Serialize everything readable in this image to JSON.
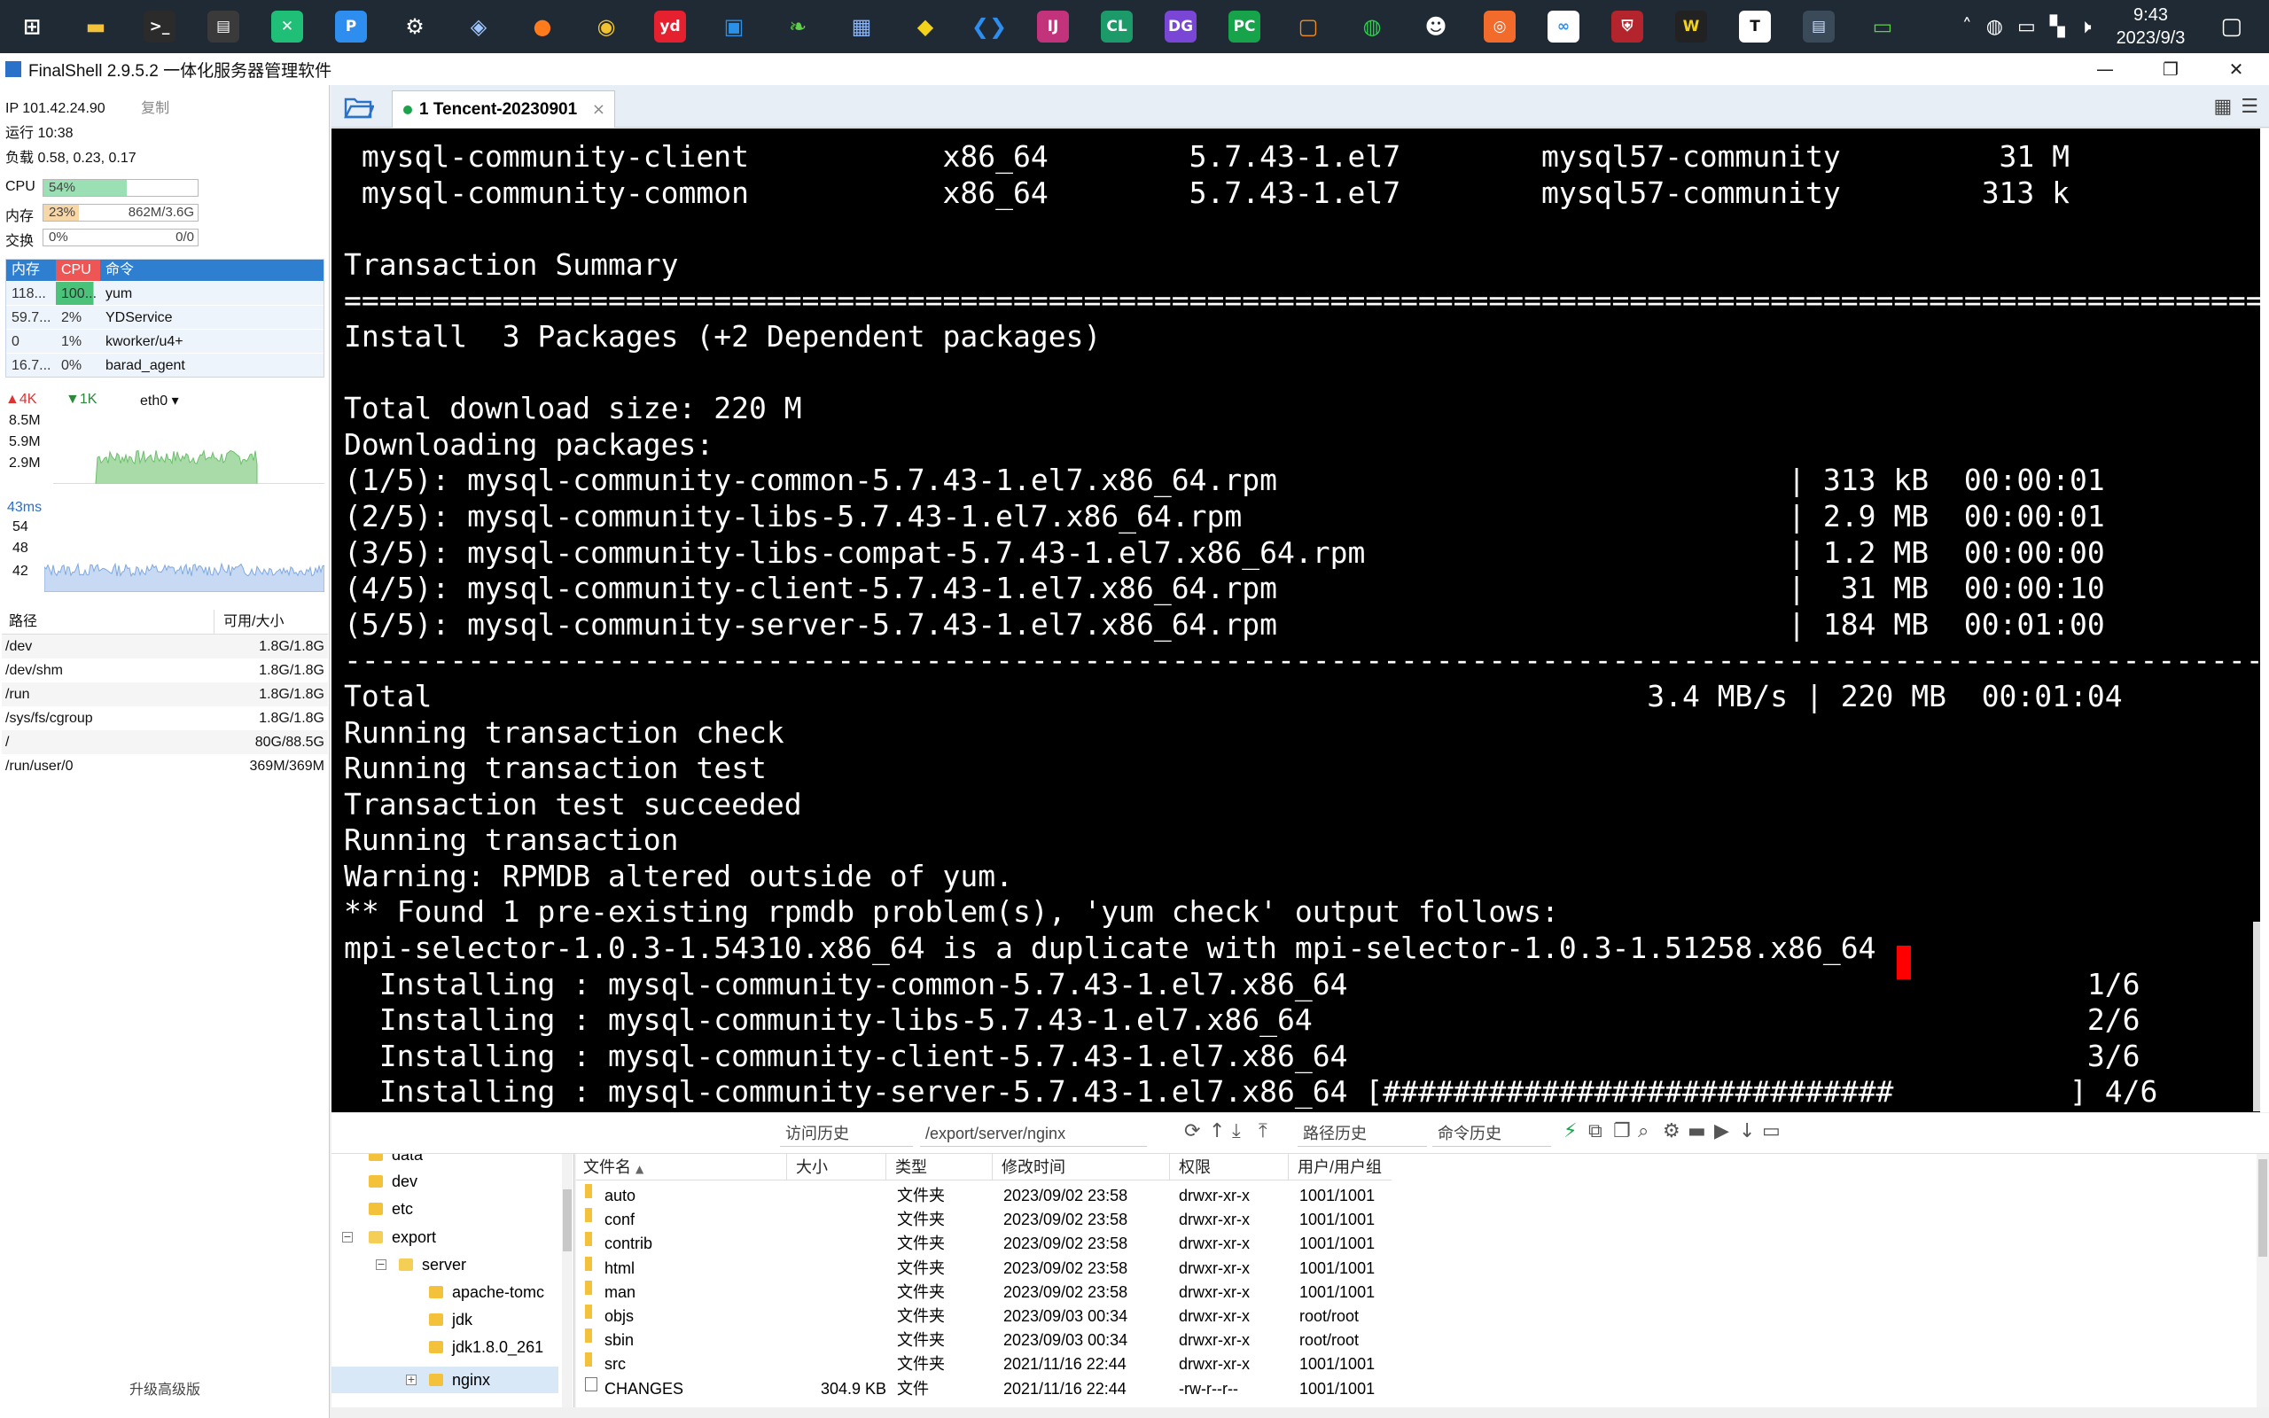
{
  "taskbar": {
    "apps": [
      {
        "name": "start-icon",
        "glyph": "⊞",
        "color": "#ffffff",
        "bg": "transparent"
      },
      {
        "name": "file-explorer-icon",
        "glyph": "▬",
        "color": "#f3c23a",
        "bg": "transparent"
      },
      {
        "name": "terminal-icon",
        "glyph": ">_",
        "color": "#ffffff",
        "bg": "#2b2b2b"
      },
      {
        "name": "terminal-alt-icon",
        "glyph": "▤",
        "color": "#ffffff",
        "bg": "#3a3a3a"
      },
      {
        "name": "xmind-icon",
        "glyph": "✕",
        "color": "#ffffff",
        "bg": "#1fbf77"
      },
      {
        "name": "notes-icon",
        "glyph": "P",
        "color": "#ffffff",
        "bg": "#2e8ef0"
      },
      {
        "name": "settings-icon",
        "glyph": "⚙",
        "color": "#ffffff",
        "bg": "transparent"
      },
      {
        "name": "network-tool-icon",
        "glyph": "◈",
        "color": "#9fc6ff",
        "bg": "transparent"
      },
      {
        "name": "firefox-icon",
        "glyph": "●",
        "color": "#ff7b1c",
        "bg": "transparent"
      },
      {
        "name": "chrome-icon",
        "glyph": "◉",
        "color": "#f2c230",
        "bg": "transparent"
      },
      {
        "name": "youdao-icon",
        "glyph": "yd",
        "color": "#ffffff",
        "bg": "#e5202f"
      },
      {
        "name": "docker-icon",
        "glyph": "▣",
        "color": "#2a90e8",
        "bg": "transparent"
      },
      {
        "name": "leaf-icon",
        "glyph": "❧",
        "color": "#5fd04a",
        "bg": "transparent"
      },
      {
        "name": "calculator-icon",
        "glyph": "▦",
        "color": "#8ab4f8",
        "bg": "transparent"
      },
      {
        "name": "gem-icon",
        "glyph": "◆",
        "color": "#f2d21a",
        "bg": "transparent"
      },
      {
        "name": "vscode-icon",
        "glyph": "❮❯",
        "color": "#2e8ef0",
        "bg": "transparent"
      },
      {
        "name": "intellij-icon",
        "glyph": "IJ",
        "color": "#ffffff",
        "bg": "#c2337c"
      },
      {
        "name": "clion-icon",
        "glyph": "CL",
        "color": "#ffffff",
        "bg": "#1c9a6a"
      },
      {
        "name": "datagrip-icon",
        "glyph": "DG",
        "color": "#ffffff",
        "bg": "#7a46d6"
      },
      {
        "name": "pycharm-icon",
        "glyph": "PC",
        "color": "#ffffff",
        "bg": "#16a34a"
      },
      {
        "name": "remote-desktop-icon",
        "glyph": "▢",
        "color": "#f28c1c",
        "bg": "transparent"
      },
      {
        "name": "wechat-icon",
        "glyph": "◍",
        "color": "#2bd14a",
        "bg": "transparent"
      },
      {
        "name": "qq-icon",
        "glyph": "☻",
        "color": "#ffffff",
        "bg": "transparent"
      },
      {
        "name": "compass-icon",
        "glyph": "◎",
        "color": "#ffffff",
        "bg": "#f26b2b"
      },
      {
        "name": "cloud-drive-icon",
        "glyph": "∞",
        "color": "#2e8ef0",
        "bg": "#ffffff"
      },
      {
        "name": "shield-icon",
        "glyph": "⛨",
        "color": "#ffffff",
        "bg": "#b3242c"
      },
      {
        "name": "wps-icon",
        "glyph": "W",
        "color": "#f2d21a",
        "bg": "#222222"
      },
      {
        "name": "typora-icon",
        "glyph": "T",
        "color": "#111111",
        "bg": "#ffffff"
      },
      {
        "name": "finalshell-icon",
        "glyph": "▤",
        "color": "#cfe3ff",
        "bg": "#3b4a58"
      },
      {
        "name": "screen-share-icon",
        "glyph": "▭",
        "color": "#5fd04a",
        "bg": "transparent"
      }
    ],
    "tray": [
      {
        "name": "tray-chevron-icon",
        "glyph": "˄"
      },
      {
        "name": "tray-wechat-icon",
        "glyph": "◍"
      },
      {
        "name": "tray-display-icon",
        "glyph": "▭"
      },
      {
        "name": "tray-grid-icon",
        "glyph": "▚"
      },
      {
        "name": "tray-volume-icon",
        "glyph": "🕨"
      }
    ],
    "time": "9:43",
    "date": "2023/9/3",
    "notification_glyph": "▢"
  },
  "window": {
    "title": "FinalShell 2.9.5.2 一体化服务器管理软件",
    "minimize": "—",
    "restore": "❐",
    "close": "✕"
  },
  "monitor": {
    "ip_label": "IP 101.42.24.90",
    "copy": "复制",
    "uptime": "运行 10:38",
    "load": "负载 0.58, 0.23, 0.17",
    "cpu_label": "CPU",
    "cpu_text": "54%",
    "cpu_pct": 54,
    "mem_label": "内存",
    "mem_text": "23%",
    "mem_right": "862M/3.6G",
    "mem_pct": 23,
    "swap_label": "交换",
    "swap_text": "0%",
    "swap_right": "0/0",
    "swap_pct": 0,
    "colors": {
      "cpu": "#9be0b4",
      "mem": "#f7d6a8"
    }
  },
  "processes": {
    "headers": [
      "内存",
      "CPU",
      "命令"
    ],
    "rows": [
      {
        "mem": "118...",
        "cpu": "100...",
        "cmd": "yum",
        "hot": true
      },
      {
        "mem": "59.7...",
        "cpu": "2%",
        "cmd": "YDService",
        "hot": false
      },
      {
        "mem": "0",
        "cpu": "1%",
        "cmd": "kworker/u4+",
        "hot": false
      },
      {
        "mem": "16.7...",
        "cpu": "0%",
        "cmd": "barad_agent",
        "hot": false
      }
    ]
  },
  "network": {
    "up": "4K",
    "down": "1K",
    "interface": "eth0",
    "y_ticks": [
      "8.5M",
      "5.9M",
      "2.9M"
    ],
    "ping_label": "43ms",
    "ping_ticks": [
      "54",
      "48",
      "42"
    ]
  },
  "disks": {
    "header_path": "路径",
    "header_size": "可用/大小",
    "rows": [
      {
        "path": "/dev",
        "size": "1.8G/1.8G"
      },
      {
        "path": "/dev/shm",
        "size": "1.8G/1.8G"
      },
      {
        "path": "/run",
        "size": "1.8G/1.8G"
      },
      {
        "path": "/sys/fs/cgroup",
        "size": "1.8G/1.8G"
      },
      {
        "path": "/",
        "size": "80G/88.5G"
      },
      {
        "path": "/run/user/0",
        "size": "369M/369M"
      }
    ]
  },
  "upgrade": "升级高级版",
  "tab": {
    "label": "1 Tencent-20230901",
    "close": "×"
  },
  "terminal": {
    "lines": [
      " mysql-community-client           x86_64        5.7.43-1.el7        mysql57-community         31 M",
      " mysql-community-common           x86_64        5.7.43-1.el7        mysql57-community        313 k",
      "",
      "Transaction Summary",
      "==============================================================================================================",
      "Install  3 Packages (+2 Dependent packages)",
      "",
      "Total download size: 220 M",
      "Downloading packages:",
      "(1/5): mysql-community-common-5.7.43-1.el7.x86_64.rpm                             | 313 kB  00:00:01",
      "(2/5): mysql-community-libs-5.7.43-1.el7.x86_64.rpm                               | 2.9 MB  00:00:01",
      "(3/5): mysql-community-libs-compat-5.7.43-1.el7.x86_64.rpm                        | 1.2 MB  00:00:00",
      "(4/5): mysql-community-client-5.7.43-1.el7.x86_64.rpm                             |  31 MB  00:00:10",
      "(5/5): mysql-community-server-5.7.43-1.el7.x86_64.rpm                             | 184 MB  00:01:00",
      "--------------------------------------------------------------------------------------------------------------",
      "Total                                                                     3.4 MB/s | 220 MB  00:01:04",
      "Running transaction check",
      "Running transaction test",
      "Transaction test succeeded",
      "Running transaction",
      "Warning: RPMDB altered outside of yum.",
      "** Found 1 pre-existing rpmdb problem(s), 'yum check' output follows:",
      "mpi-selector-1.0.3-1.54310.x86_64 is a duplicate with mpi-selector-1.0.3-1.51258.x86_64",
      "  Installing : mysql-community-common-5.7.43-1.el7.x86_64                                          1/6",
      "  Installing : mysql-community-libs-5.7.43-1.el7.x86_64                                            2/6",
      "  Installing : mysql-community-client-5.7.43-1.el7.x86_64                                          3/6",
      "  Installing : mysql-community-server-5.7.43-1.el7.x86_64 [#############################          ] 4/6"
    ]
  },
  "toolbar": {
    "history": "访问历史",
    "path": "/export/server/nginx",
    "path_history": "路径历史",
    "cmd_history": "命令历史"
  },
  "tree": {
    "nodes": [
      "data",
      "dev",
      "etc",
      "export",
      "server",
      "apache-tomc",
      "jdk",
      "jdk1.8.0_261",
      "nginx"
    ]
  },
  "files": {
    "headers": {
      "name": "文件名",
      "size": "大小",
      "type": "类型",
      "mtime": "修改时间",
      "perm": "权限",
      "owner": "用户/用户组"
    },
    "sort_glyph": "▲",
    "rows": [
      {
        "name": "auto",
        "size": "",
        "type": "文件夹",
        "mtime": "2023/09/02 23:58",
        "perm": "drwxr-xr-x",
        "owner": "1001/1001",
        "dir": true
      },
      {
        "name": "conf",
        "size": "",
        "type": "文件夹",
        "mtime": "2023/09/02 23:58",
        "perm": "drwxr-xr-x",
        "owner": "1001/1001",
        "dir": true
      },
      {
        "name": "contrib",
        "size": "",
        "type": "文件夹",
        "mtime": "2023/09/02 23:58",
        "perm": "drwxr-xr-x",
        "owner": "1001/1001",
        "dir": true
      },
      {
        "name": "html",
        "size": "",
        "type": "文件夹",
        "mtime": "2023/09/02 23:58",
        "perm": "drwxr-xr-x",
        "owner": "1001/1001",
        "dir": true
      },
      {
        "name": "man",
        "size": "",
        "type": "文件夹",
        "mtime": "2023/09/02 23:58",
        "perm": "drwxr-xr-x",
        "owner": "1001/1001",
        "dir": true
      },
      {
        "name": "objs",
        "size": "",
        "type": "文件夹",
        "mtime": "2023/09/03 00:34",
        "perm": "drwxr-xr-x",
        "owner": "root/root",
        "dir": true
      },
      {
        "name": "sbin",
        "size": "",
        "type": "文件夹",
        "mtime": "2023/09/03 00:34",
        "perm": "drwxr-xr-x",
        "owner": "root/root",
        "dir": true
      },
      {
        "name": "src",
        "size": "",
        "type": "文件夹",
        "mtime": "2021/11/16 22:44",
        "perm": "drwxr-xr-x",
        "owner": "1001/1001",
        "dir": true
      },
      {
        "name": "CHANGES",
        "size": "304.9 KB",
        "type": "文件",
        "mtime": "2021/11/16 22:44",
        "perm": "-rw-r--r--",
        "owner": "1001/1001",
        "dir": false
      }
    ]
  }
}
